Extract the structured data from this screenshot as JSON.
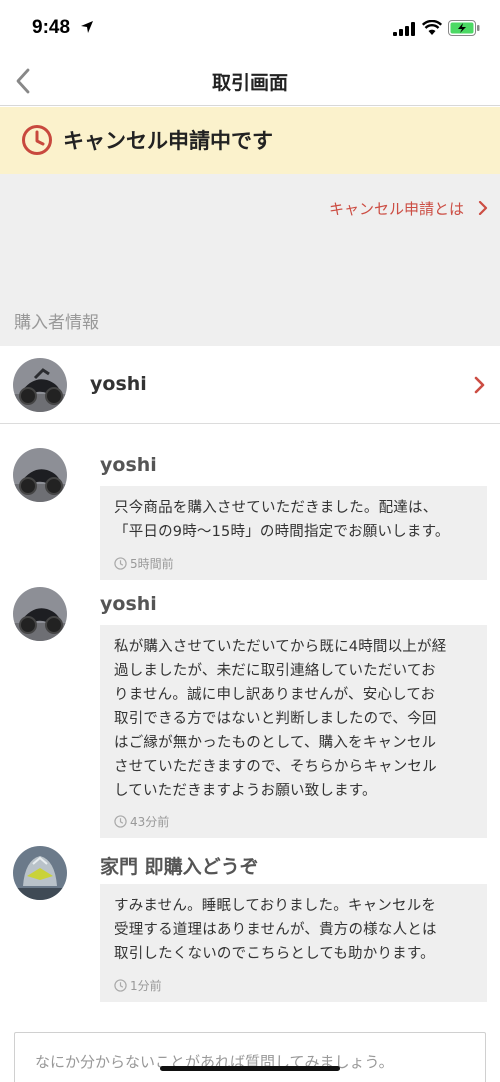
{
  "status_bar": {
    "time": "9:48"
  },
  "nav": {
    "title": "取引画面"
  },
  "banner": {
    "text": "キャンセル申請中です",
    "accent_color": "#c8493e"
  },
  "cancel_info_link": "キャンセル申請とは",
  "buyer_section": {
    "label": "購入者情報",
    "name": "yoshi"
  },
  "messages": [
    {
      "name": "yoshi",
      "text": "只今商品を購入させていただきました。配達は、\n「平日の9時〜15時」の時間指定でお願いします。",
      "time": "5時間前"
    },
    {
      "name": "yoshi",
      "text": "私が購入させていただいてから既に4時間以上が経\n過しましたが、未だに取引連絡していただいてお\nりません。誠に申し訳ありませんが、安心してお\n取引できる方ではないと判断しましたので、今回\nはご縁が無かったものとして、購入をキャンセル\nさせていただきますので、そちらからキャンセル\nしていただきますようお願い致します。",
      "time": "43分前"
    },
    {
      "name": "家門 即購入どうぞ",
      "text": "すみません。睡眠しておりました。キャンセルを\n受理する道理はありませんが、貴方の様な人とは\n取引したくないのでこちらとしても助かります。",
      "time": "1分前"
    }
  ],
  "input": {
    "placeholder": "なにか分からないことがあれば質問してみましょう。"
  }
}
